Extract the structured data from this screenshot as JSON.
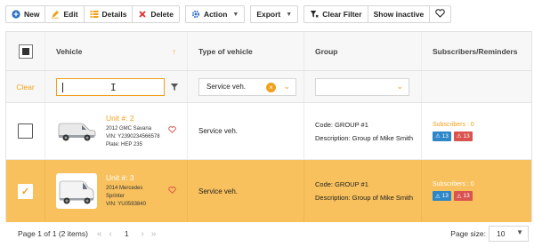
{
  "toolbar": {
    "new_label": "New",
    "edit_label": "Edit",
    "details_label": "Details",
    "delete_label": "Delete",
    "action_label": "Action",
    "export_label": "Export",
    "clear_filter_label": "Clear Filter",
    "show_inactive_label": "Show inactive"
  },
  "columns": {
    "vehicle": "Vehicle",
    "type": "Type of vehicle",
    "group": "Group",
    "subscribers": "Subscribers/Reminders"
  },
  "filters": {
    "clear_label": "Clear",
    "vehicle_value": "",
    "type_value": "Service veh.",
    "group_value": ""
  },
  "rows": [
    {
      "unit": "Unit #: 2",
      "model": "2012 GMC Savana",
      "vin": "VIN: Y2390234566578",
      "plate": "Plate: HEP 235",
      "type": "Service veh.",
      "group_code": "Code: GROUP #1",
      "group_desc": "Description: Group of Mike Smith",
      "subscribers": "Subscribers : 0",
      "badge_blue": "13",
      "badge_red": "13",
      "selected": false
    },
    {
      "unit": "Unit #: 3",
      "model": "2014 Mercedes",
      "model2": "Sprinter",
      "vin": "VIN: YU0593840",
      "type": "Service veh.",
      "group_code": "Code: GROUP #1",
      "group_desc": "Description: Group of Mike Smith",
      "subscribers": "Subscribers : 0",
      "badge_blue": "13",
      "badge_red": "13",
      "selected": true
    }
  ],
  "pager": {
    "info": "Page 1 of 1 (2 items)",
    "current_page": "1",
    "size_label": "Page size:",
    "size_value": "10"
  },
  "colors": {
    "accent": "#f0a11b",
    "selected_row": "#f8c15d",
    "badge_blue": "#2d87c9",
    "badge_red": "#d9534f"
  }
}
